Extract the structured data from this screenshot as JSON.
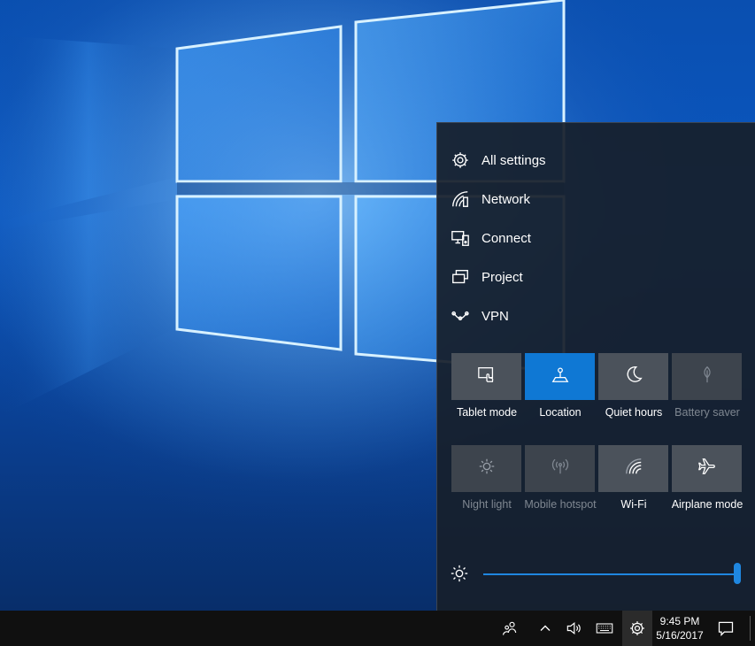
{
  "action_center": {
    "quick_links": [
      {
        "label": "All settings",
        "icon": "gear-icon"
      },
      {
        "label": "Network",
        "icon": "network-icon"
      },
      {
        "label": "Connect",
        "icon": "connect-icon"
      },
      {
        "label": "Project",
        "icon": "project-icon"
      },
      {
        "label": "VPN",
        "icon": "vpn-icon"
      }
    ],
    "tiles": [
      {
        "label": "Tablet mode",
        "icon": "tablet-mode-icon",
        "state": "off"
      },
      {
        "label": "Location",
        "icon": "location-icon",
        "state": "on"
      },
      {
        "label": "Quiet hours",
        "icon": "moon-icon",
        "state": "off"
      },
      {
        "label": "Battery saver",
        "icon": "leaf-icon",
        "state": "disabled"
      },
      {
        "label": "Night light",
        "icon": "night-light-icon",
        "state": "disabled"
      },
      {
        "label": "Mobile hotspot",
        "icon": "hotspot-icon",
        "state": "disabled"
      },
      {
        "label": "Wi-Fi",
        "icon": "wifi-icon",
        "state": "off"
      },
      {
        "label": "Airplane mode",
        "icon": "airplane-icon",
        "state": "off"
      }
    ],
    "brightness": {
      "icon": "brightness-icon",
      "value_percent": 100
    }
  },
  "taskbar": {
    "tray_icons": [
      "people-icon",
      "chevron-up-icon",
      "volume-icon",
      "keyboard-icon",
      "gear-icon"
    ],
    "time": "9:45 PM",
    "date": "5/16/2017",
    "notification_icon": "notification-icon"
  },
  "colors": {
    "accent": "#0f78d4",
    "panel_bg": "#171f2b",
    "tile_bg": "#4b525b",
    "taskbar_bg": "#101010"
  }
}
